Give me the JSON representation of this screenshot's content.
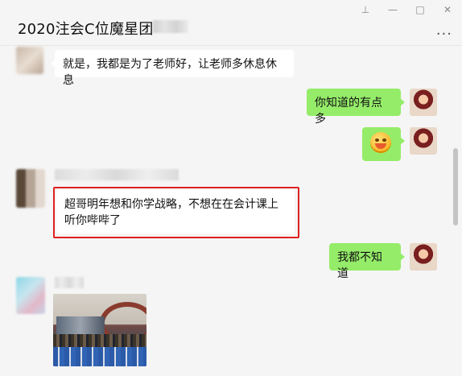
{
  "window": {
    "title": "2020注会C位魔星团",
    "controls": {
      "pin": "⊥",
      "minimize": "—",
      "maximize": "□",
      "close": "✕"
    },
    "more_label": "..."
  },
  "messages": [
    {
      "side": "in",
      "text": "就是，我都是为了老师好，让老师多休息休息"
    },
    {
      "side": "out",
      "text": "你知道的有点多"
    },
    {
      "side": "out",
      "type": "emoji",
      "icon": "grinning-face-emoji"
    },
    {
      "side": "in",
      "text": "超哥明年想和你学战略，不想在在会计课上听你哔哔了",
      "highlighted": true
    },
    {
      "side": "out",
      "text": "我都不知道"
    },
    {
      "side": "in",
      "type": "image",
      "icon": "amusement-park-photo"
    }
  ],
  "colors": {
    "outgoing_bubble": "#95ec69",
    "incoming_bubble": "#ffffff",
    "background": "#f5f5f5",
    "highlight": "#e02020"
  }
}
